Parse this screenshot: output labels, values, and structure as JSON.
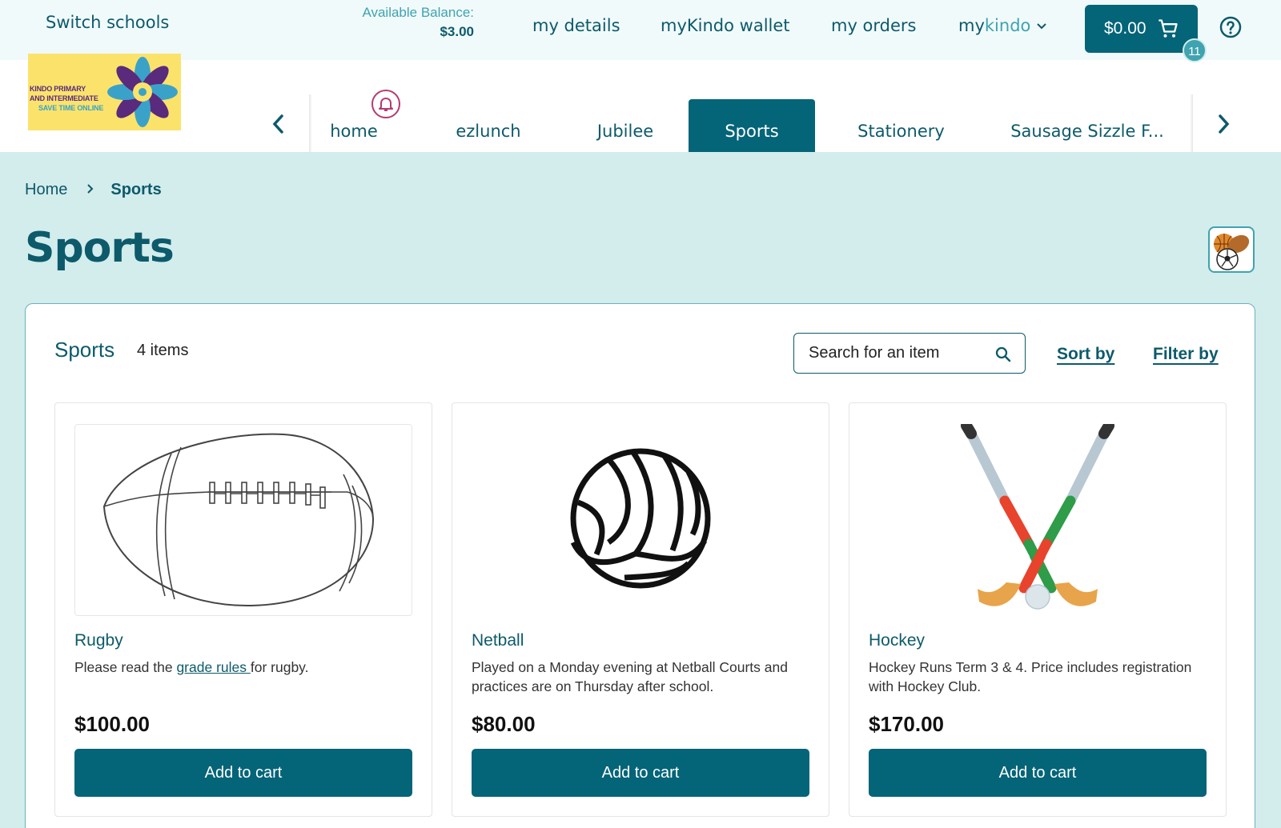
{
  "header": {
    "switch_schools": "Switch schools",
    "balance_label": "Available Balance:",
    "balance_value": "$3.00",
    "links": {
      "my_details": "my details",
      "wallet": "myKindo wallet",
      "orders": "my orders",
      "mykindo_prefix": "my",
      "mykindo_suffix": "kindo"
    },
    "cart_total": "$0.00",
    "cart_count": "11",
    "logo": {
      "line1": "KINDO PRIMARY",
      "line2": "AND INTERMEDIATE",
      "line3": "SAVE TIME ONLINE"
    }
  },
  "nav": {
    "tabs": [
      {
        "label": "home"
      },
      {
        "label": "ezlunch"
      },
      {
        "label": "Jubilee"
      },
      {
        "label": "Sports"
      },
      {
        "label": "Stationery"
      },
      {
        "label": "Sausage Sizzle F..."
      }
    ],
    "active": "Sports"
  },
  "breadcrumb": {
    "home": "Home",
    "current": "Sports"
  },
  "page": {
    "title": "Sports"
  },
  "panel": {
    "title": "Sports",
    "count": "4 items",
    "search_placeholder": "Search for an item",
    "sort_label": "Sort by",
    "filter_label": "Filter by"
  },
  "products": [
    {
      "name": "Rugby",
      "desc_prefix": "Please read the ",
      "desc_link": "grade rules ",
      "desc_suffix": "for rugby.",
      "price": "$100.00",
      "button": "Add to cart"
    },
    {
      "name": "Netball",
      "desc": "Played on a Monday evening at Netball Courts and practices are on Thursday after school.",
      "price": "$80.00",
      "button": "Add to cart"
    },
    {
      "name": "Hockey",
      "desc": "Hockey Runs Term 3 & 4. Price includes registration with Hockey Club.",
      "price": "$170.00",
      "button": "Add to cart"
    }
  ],
  "colors": {
    "primary": "#046478",
    "accent": "#3fa3b0",
    "page_bg": "#d3ecec",
    "bell": "#b53b72"
  }
}
